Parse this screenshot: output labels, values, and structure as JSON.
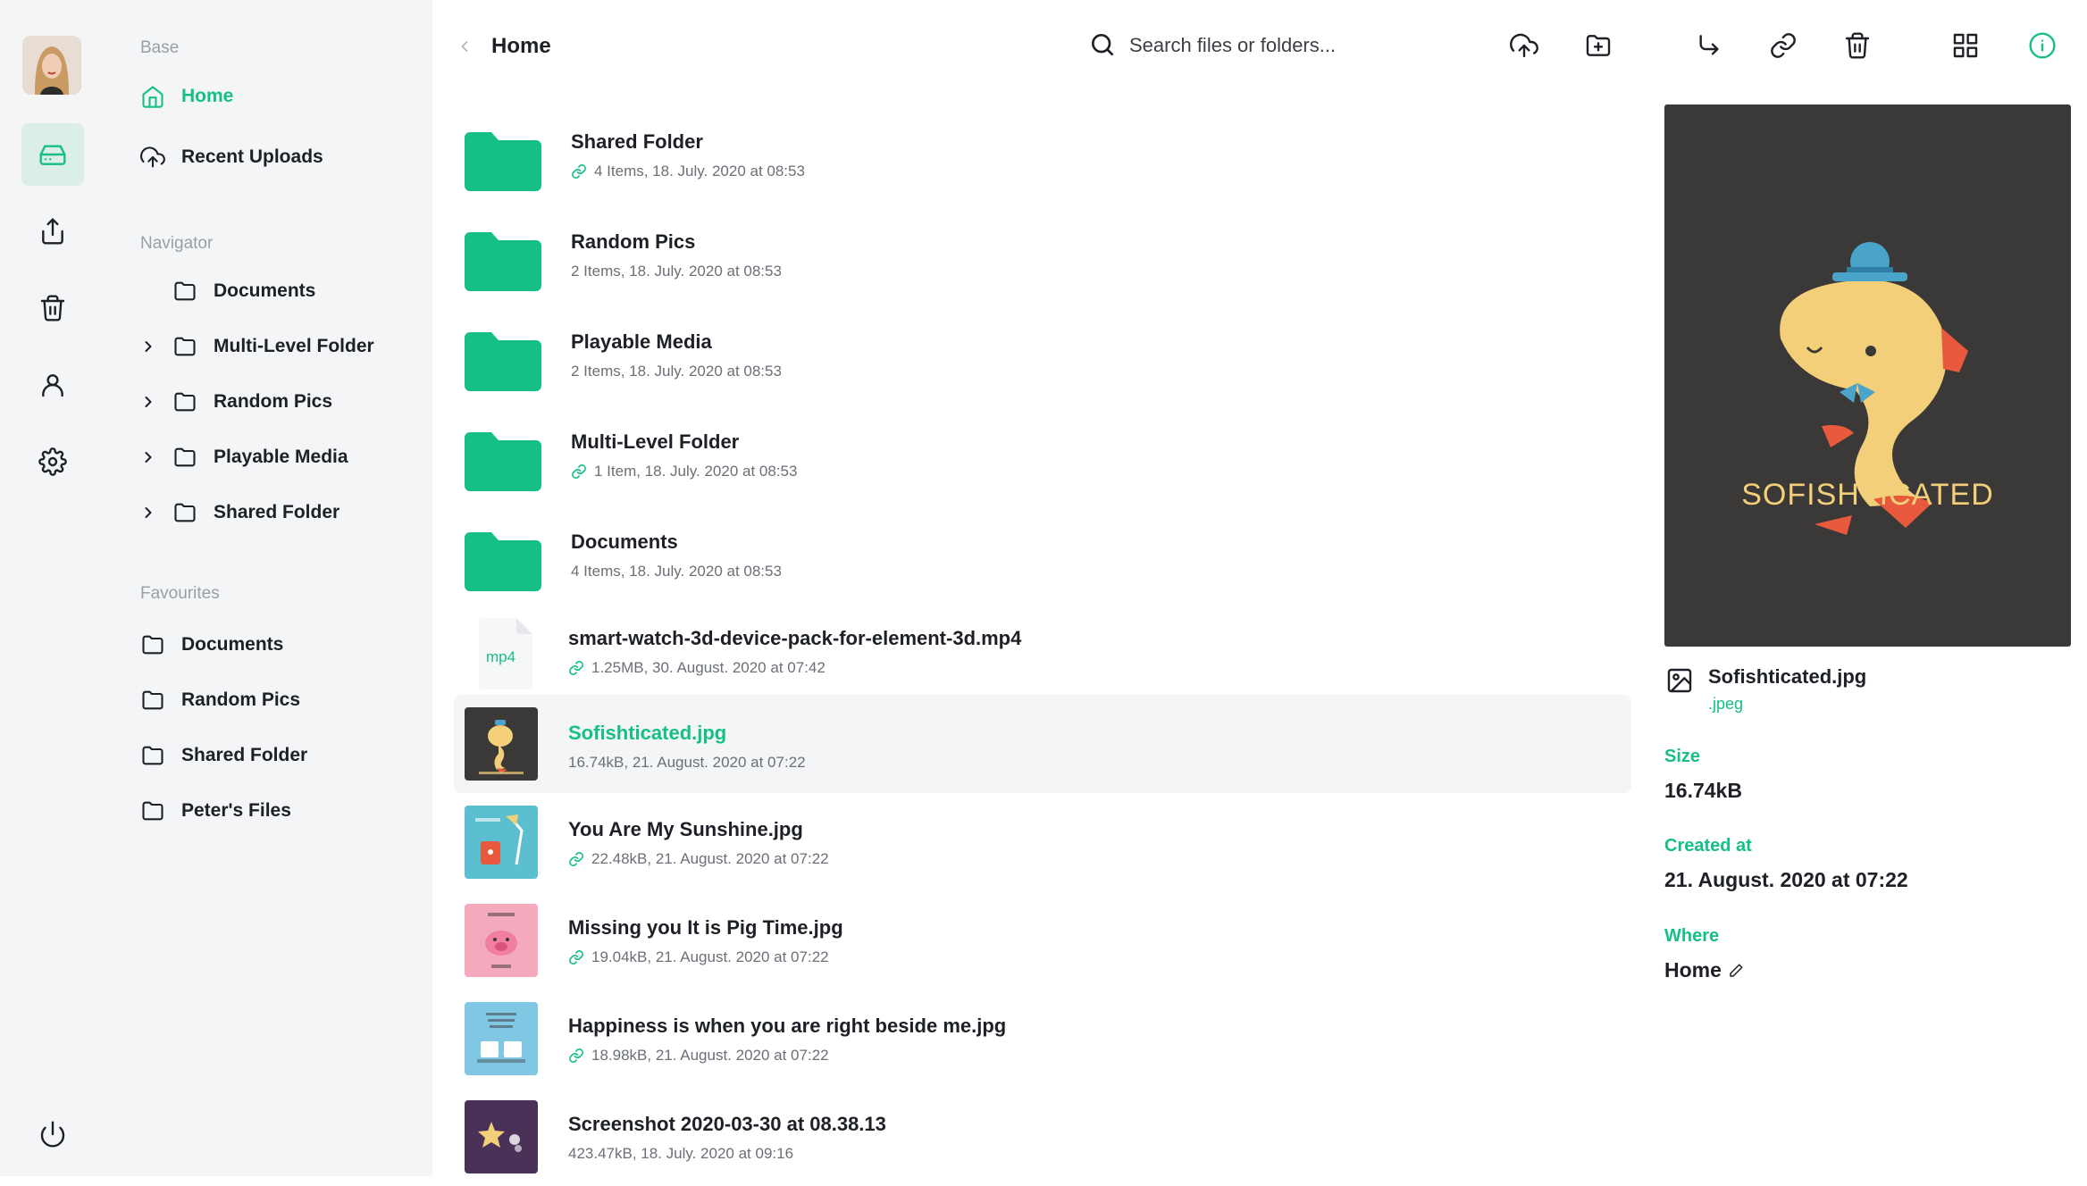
{
  "rail": {
    "icons": [
      "avatar",
      "drive-icon",
      "upload-icon",
      "trash-icon",
      "user-icon",
      "settings-icon",
      "power-icon"
    ]
  },
  "sidebar": {
    "base_title": "Base",
    "base_items": [
      {
        "label": "Home",
        "icon": "home-icon"
      },
      {
        "label": "Recent Uploads",
        "icon": "upload-cloud-icon"
      }
    ],
    "navigator_title": "Navigator",
    "navigator_items": [
      {
        "label": "Documents"
      },
      {
        "label": "Multi-Level Folder"
      },
      {
        "label": "Random Pics"
      },
      {
        "label": "Playable Media"
      },
      {
        "label": "Shared Folder"
      }
    ],
    "favourites_title": "Favourites",
    "favourites_items": [
      {
        "label": "Documents"
      },
      {
        "label": "Random Pics"
      },
      {
        "label": "Shared Folder"
      },
      {
        "label": "Peter's Files"
      }
    ]
  },
  "header": {
    "breadcrumb": "Home",
    "search_placeholder": "Search files or folders..."
  },
  "toolbar": [
    "upload-icon",
    "new-folder-icon",
    "move-icon",
    "link-icon",
    "trash-icon",
    "grid-icon",
    "info-icon"
  ],
  "files": [
    {
      "name": "Shared Folder",
      "meta": "4 Items, 18. July. 2020 at 08:53",
      "shared": true
    },
    {
      "name": "Random Pics",
      "meta": "2 Items, 18. July. 2020 at 08:53",
      "shared": false
    },
    {
      "name": "Playable Media",
      "meta": "2 Items, 18. July. 2020 at 08:53",
      "shared": false
    },
    {
      "name": "Multi-Level Folder",
      "meta": "1 Item, 18. July. 2020 at 08:53",
      "shared": true
    },
    {
      "name": "Documents",
      "meta": "4 Items, 18. July. 2020 at 08:53",
      "shared": false
    },
    {
      "name": "smart-watch-3d-device-pack-for-element-3d.mp4",
      "meta": "1.25MB, 30. August. 2020 at 07:42",
      "shared": true,
      "ext": "mp4"
    },
    {
      "name": "Sofishticated.jpg",
      "meta": "16.74kB, 21. August. 2020 at 07:22",
      "shared": false
    },
    {
      "name": "You Are My Sunshine.jpg",
      "meta": "22.48kB, 21. August. 2020 at 07:22",
      "shared": true
    },
    {
      "name": "Missing you It is Pig Time.jpg",
      "meta": "19.04kB, 21. August. 2020 at 07:22",
      "shared": true
    },
    {
      "name": "Happiness is when you are right beside me.jpg",
      "meta": "18.98kB, 21. August. 2020 at 07:22",
      "shared": true
    },
    {
      "name": "Screenshot 2020-03-30 at 08.38.13",
      "meta": "423.47kB, 18. July. 2020 at 09:16",
      "shared": false
    }
  ],
  "info": {
    "preview_text": "SOFISHTICATED",
    "file_name": "Sofishticated.jpg",
    "file_ext": ".jpeg",
    "size_label": "Size",
    "size_value": "16.74kB",
    "created_label": "Created at",
    "created_value": "21. August. 2020 at 07:22",
    "where_label": "Where",
    "where_value": "Home"
  },
  "colors": {
    "accent": "#16bf85",
    "sidebar_bg": "#f4f5f6",
    "preview_bg": "#3b3838"
  }
}
